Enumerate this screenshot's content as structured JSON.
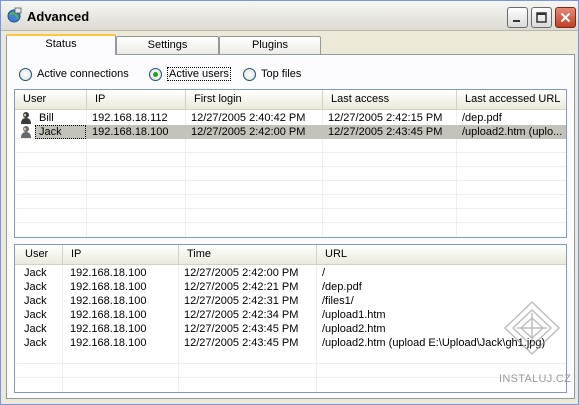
{
  "window": {
    "title": "Advanced",
    "app_icon": "app-globe-icon",
    "caption_buttons": [
      "minimize-icon",
      "maximize-icon",
      "close-icon"
    ]
  },
  "tabs": [
    {
      "label": "Status",
      "active": true
    },
    {
      "label": "Settings",
      "active": false
    },
    {
      "label": "Plugins",
      "active": false
    }
  ],
  "view_options": [
    {
      "label": "Active connections",
      "selected": false
    },
    {
      "label": "Active users",
      "selected": true
    },
    {
      "label": "Top files",
      "selected": false
    }
  ],
  "users_table": {
    "columns": [
      "User",
      "IP",
      "First login",
      "Last access",
      "Last accessed URL"
    ],
    "rows": [
      {
        "icon": "user-icon",
        "user": "Bill",
        "ip": "192.168.18.112",
        "first_login": "12/27/2005 2:40:42 PM",
        "last_access": "12/27/2005 2:42:15 PM",
        "url": "/dep.pdf",
        "selected": false
      },
      {
        "icon": "user-icon",
        "user": "Jack",
        "ip": "192.168.18.100",
        "first_login": "12/27/2005 2:42:00 PM",
        "last_access": "12/27/2005 2:43:45 PM",
        "url": "/upload2.htm (uplo...",
        "selected": true
      }
    ]
  },
  "log_table": {
    "columns": [
      "User",
      "IP",
      "Time",
      "URL"
    ],
    "rows": [
      {
        "user": "Jack",
        "ip": "192.168.18.100",
        "time": "12/27/2005 2:42:00 PM",
        "url": "/"
      },
      {
        "user": "Jack",
        "ip": "192.168.18.100",
        "time": "12/27/2005 2:42:21 PM",
        "url": "/dep.pdf"
      },
      {
        "user": "Jack",
        "ip": "192.168.18.100",
        "time": "12/27/2005 2:42:31 PM",
        "url": "/files1/"
      },
      {
        "user": "Jack",
        "ip": "192.168.18.100",
        "time": "12/27/2005 2:42:34 PM",
        "url": "/upload1.htm"
      },
      {
        "user": "Jack",
        "ip": "192.168.18.100",
        "time": "12/27/2005 2:43:45 PM",
        "url": "/upload2.htm"
      },
      {
        "user": "Jack",
        "ip": "192.168.18.100",
        "time": "12/27/2005 2:43:45 PM",
        "url": "/upload2.htm (upload E:\\Upload\\Jack\\gh1.jpg)"
      }
    ]
  },
  "watermark": {
    "text": "INSTALUJ.CZ",
    "icon": "instaluj-logo-icon"
  }
}
